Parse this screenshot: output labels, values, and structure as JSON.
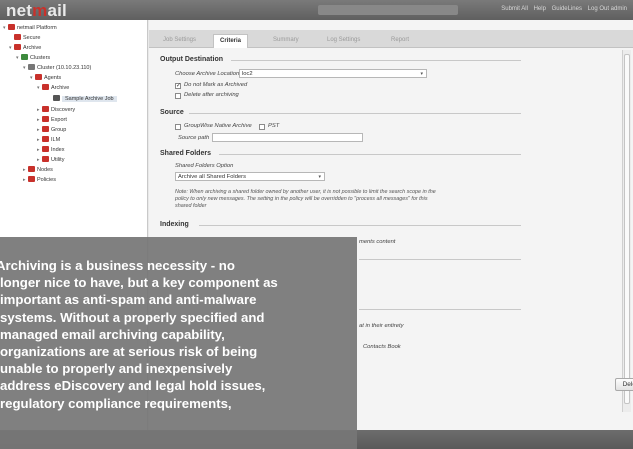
{
  "app": {
    "logo_main": "net",
    "logo_accent": "m",
    "logo_tail": "ail",
    "top_links": [
      "Submit All",
      "Help",
      "GuideLines",
      "Log Out admin"
    ]
  },
  "tree": [
    {
      "label": "netmail Platform",
      "icon": "platform-icon",
      "color": "#c8312b"
    },
    {
      "label": "Secure",
      "icon": "secure-icon",
      "color": "#c8312b"
    },
    {
      "label": "Archive",
      "icon": "archive-icon",
      "color": "#c8312b"
    },
    {
      "label": "Clusters",
      "icon": "clusters-icon",
      "color": "#3d8a3d"
    },
    {
      "label": "Cluster (10.10.23.110)",
      "icon": "cluster-icon",
      "color": "#777777"
    },
    {
      "label": "Agents",
      "icon": "agents-icon",
      "color": "#c8312b"
    },
    {
      "label": "Archive",
      "icon": "archive-agent-icon",
      "color": "#c8312b"
    },
    {
      "label": "Sample Archive Job",
      "icon": "job-icon",
      "color": "#555555"
    },
    {
      "label": "Discovery",
      "icon": "discovery-icon",
      "color": "#c8312b"
    },
    {
      "label": "Export",
      "icon": "export-icon",
      "color": "#c8312b"
    },
    {
      "label": "Group",
      "icon": "group-icon",
      "color": "#c8312b"
    },
    {
      "label": "ILM",
      "icon": "ilm-icon",
      "color": "#c8312b"
    },
    {
      "label": "Index",
      "icon": "index-icon",
      "color": "#c8312b"
    },
    {
      "label": "Utility",
      "icon": "utility-icon",
      "color": "#c8312b"
    },
    {
      "label": "Nodes",
      "icon": "nodes-icon",
      "color": "#c8312b"
    },
    {
      "label": "Policies",
      "icon": "policies-icon",
      "color": "#c8312b"
    }
  ],
  "tabs": [
    "Job Settings",
    "Criteria",
    "Summary",
    "Log Settings",
    "Report"
  ],
  "form": {
    "output_title": "Output Destination",
    "archive_location_label": "Choose Archive Location",
    "archive_location_value": "loc2",
    "do_not_mark_label": "Do not Mark as Archived",
    "delete_after_label": "Delete after archiving",
    "source_title": "Source",
    "groupwise_label": "GroupWise Native Archive",
    "pst_label": "PST",
    "source_path_label": "Source path",
    "shared_title": "Shared Folders",
    "shared_option_label": "Shared Folders Option",
    "shared_option_value": "Archive all Shared Folders",
    "note_text": "Note: When archiving a shared folder owned by another user, it is not possible to limit the search scope in the\npolicy to only new messages. The setting in the policy will be overridden to \"process all messages\" for this\nshared folder",
    "indexing_title": "Indexing",
    "attachments_fragment": "ments content",
    "entirety_fragment": "at in their entirety",
    "contacts_fragment": "Contacts Book"
  },
  "buttons": {
    "delete_label": "Delete"
  },
  "quote": {
    "text": "Archiving is a business necessity - no\nlonger nice to have, but a key component as\nimportant as anti-spam and anti-malware\nsystems. Without a properly specified and\nmanaged email archiving capability,\norganizations are at serious risk of being\nunable to properly and inexpensively\naddress eDiscovery and legal hold issues,\nregulatory compliance requirements,"
  }
}
